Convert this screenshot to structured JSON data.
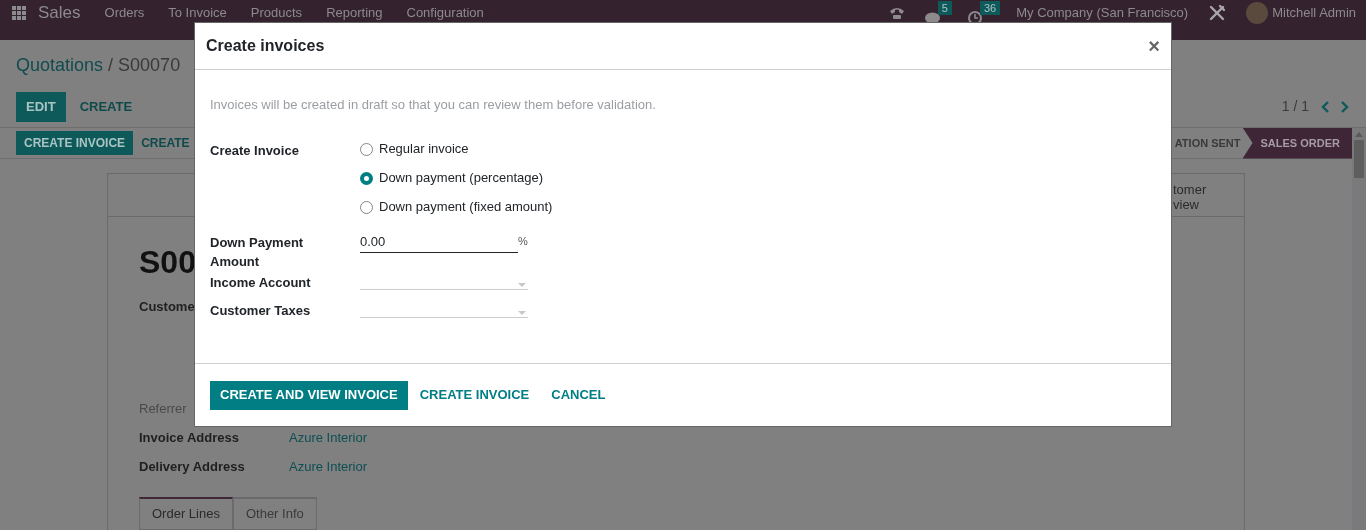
{
  "navbar": {
    "app": "Sales",
    "menu": [
      "Orders",
      "To Invoice",
      "Products",
      "Reporting",
      "Configuration"
    ],
    "messages_count": "5",
    "activities_count": "36",
    "company": "My Company (San Francisco)",
    "user": "Mitchell Admin"
  },
  "breadcrumb": {
    "parent": "Quotations",
    "separator": "/",
    "current": "S00070"
  },
  "actions": [
    "EDIT",
    "CREATE"
  ],
  "pager": "1 / 1",
  "statusbar": {
    "buttons": [
      "CREATE INVOICE",
      "CREATE"
    ],
    "stages": [
      {
        "label": "ATION SENT",
        "selected": false
      },
      {
        "label": "SALES ORDER",
        "selected": true
      }
    ]
  },
  "sheet": {
    "smart_button": "tomer\nview",
    "title": "S00",
    "customer_label": "Custome",
    "fields": [
      {
        "label": "Referrer",
        "kind": "muted"
      },
      {
        "label": "Invoice Address",
        "value": "Azure Interior",
        "kind": "normal"
      },
      {
        "label": "Delivery Address",
        "value": "Azure Interior",
        "kind": "normal"
      }
    ],
    "tabs": [
      {
        "label": "Order Lines",
        "selected": true
      },
      {
        "label": "Other Info",
        "selected": false
      }
    ]
  },
  "modal": {
    "title": "Create invoices",
    "close": "×",
    "intro": "Invoices will be created in draft so that you can review them before validation.",
    "invoice_label": "Create Invoice",
    "invoice_options": [
      {
        "label": "Regular invoice",
        "selected": false
      },
      {
        "label": "Down payment (percentage)",
        "selected": true
      },
      {
        "label": "Down payment (fixed amount)",
        "selected": false
      }
    ],
    "fields": [
      {
        "label": "Down Payment Amount",
        "kind": "number",
        "value": "0.00",
        "suffix": "%"
      },
      {
        "label": "Income Account",
        "kind": "select"
      },
      {
        "label": "Customer Taxes",
        "kind": "select"
      }
    ],
    "buttons": [
      {
        "label": "CREATE AND VIEW INVOICE",
        "kind": "primary"
      },
      {
        "label": "CREATE INVOICE",
        "kind": "link"
      },
      {
        "label": "CANCEL",
        "kind": "link"
      }
    ]
  }
}
